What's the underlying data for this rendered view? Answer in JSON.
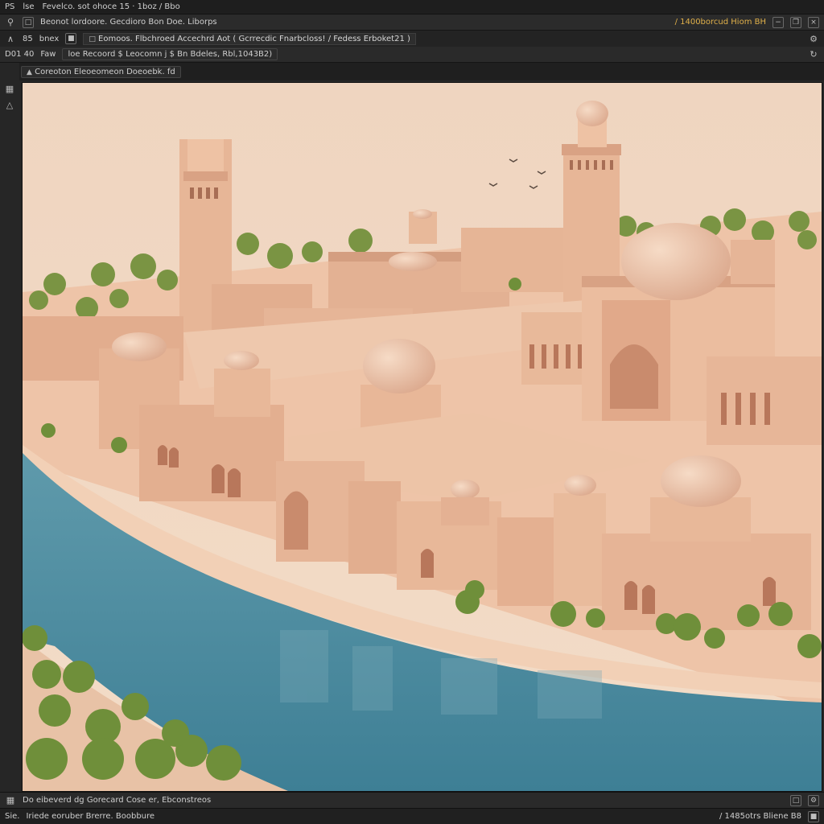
{
  "menubar": {
    "app_label": "PS",
    "menu_label": "lse",
    "title": "Fevelco. sot ohoce 15 · 1boz / Bbo"
  },
  "optbar": {
    "breadcrumb": "Beonot lordoore. Gecdioro Bon Doe. Liborps",
    "right_text": "/ 1400borcud Hiom BH"
  },
  "tabbar": {
    "left_a": "85",
    "left_b": "bnex",
    "tab_label": "Eomoos. Flbchroed Accechrd Aot ( Gcrrecdic Fnarbcloss! / Fedess Erboket21 )"
  },
  "infobar": {
    "coords": "D01 40",
    "label": "Faw",
    "field": "loe Recoord $ Leocomn j $ Bn Bdeles, Rbl,1043B2)"
  },
  "docbar": {
    "doc_tab": "Coreoton Eleoeomeon Doeoebk. fd"
  },
  "statusbar1": {
    "text": "Do eibeverd dg Gorecard Cose er, Ebconstreos"
  },
  "statusbar2": {
    "left": "Sie.",
    "text": "Iriede eoruber Brerre. Boobbure",
    "right": "/ 1485otrs Bliene B8"
  },
  "colors": {
    "ui_bg": "#262626",
    "accent": "#e0b04a",
    "sky": "#f1d9c4",
    "sandstone": "#e8b99a",
    "water": "#4f8fa2",
    "tree": "#6f8f3a"
  }
}
